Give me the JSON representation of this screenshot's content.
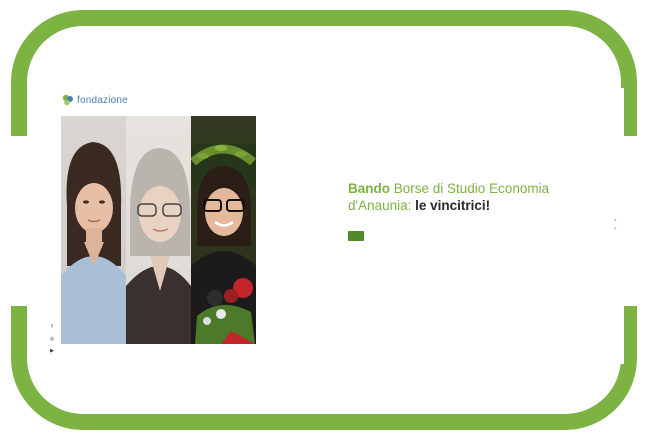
{
  "brand": {
    "name": "fondazione",
    "tagline": "",
    "accent": "#7cb342",
    "button_color": "#4f8a2b"
  },
  "nav": {
    "items": [
      "",
      "",
      "",
      "",
      ""
    ]
  },
  "hero": {
    "title_bold": "Bando",
    "title_regular": " Borse di Studio Economia d'Anaunia: ",
    "title_highlight": "le vincitrici!",
    "body_prefix": "",
    "body_bold": "",
    "body_suffix": "",
    "cta_label": ""
  },
  "social": {
    "icons": [
      "facebook-icon",
      "instagram-icon",
      "youtube-icon"
    ]
  },
  "slider": {
    "dots": 2
  }
}
